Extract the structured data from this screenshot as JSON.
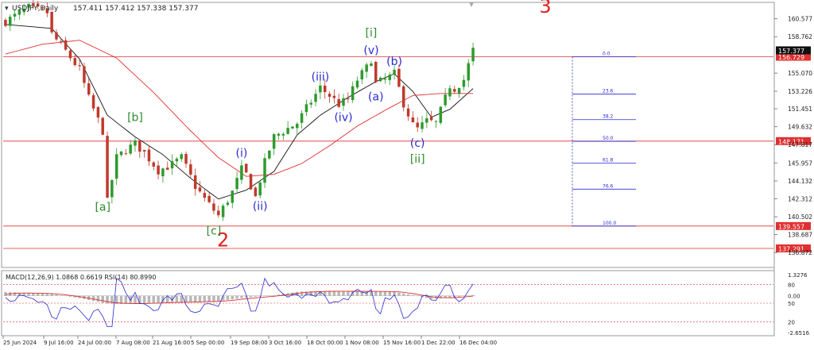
{
  "window": {
    "symbol_label": "USDJPY,Daily",
    "ohlc_label": "157.411 157.412 157.338 157.377"
  },
  "colors": {
    "bull": "#2e9a2e",
    "bear": "#c0392b",
    "ma_fast": "#111111",
    "ma_slow": "#e03030",
    "hline": "#e03030",
    "wave_blue": "#2a2ad0",
    "wave_green": "#2e8b2e",
    "wave_red": "#e02020",
    "fib": "#2a2ad0",
    "price_tag": "#111111"
  },
  "chart_data": [
    {
      "type": "candlestick",
      "title": "USDJPY,Daily",
      "subtitle": "157.411 157.412 157.338 157.377",
      "ylim": [
        135.6,
        162.0
      ],
      "x_tick_labels": [
        "25 Jun 2024",
        "9 Jul 16:00",
        "24 Jul 00:00",
        "7 Aug 08:00",
        "21 Aug 16:00",
        "5 Sep 00:00",
        "19 Sep 08:00",
        "3 Oct 16:00",
        "18 Oct 00:00",
        "1 Nov 08:00",
        "15 Nov 16:00",
        "1 Dec 22:00",
        "16 Dec 04:00"
      ],
      "y_tick_labels": [
        "160.577",
        "158.762",
        "155.070",
        "153.226",
        "151.451",
        "149.632",
        "147.817",
        "145.957",
        "144.132",
        "142.312",
        "140.502",
        "138.687",
        "136.872"
      ],
      "current_price": "157.377",
      "horizontal_levels": [
        {
          "value": 156.729,
          "label": "156.729"
        },
        {
          "value": 148.171,
          "label": "148.171"
        },
        {
          "value": 139.557,
          "label": "139.557"
        },
        {
          "value": 137.291,
          "label": "137.291"
        }
      ],
      "fib_levels": [
        {
          "label": "0.0",
          "value": 156.73
        },
        {
          "label": "23.6",
          "value": 152.95
        },
        {
          "label": "38.2",
          "value": 150.35
        },
        {
          "label": "50.0",
          "value": 148.15
        },
        {
          "label": "61.8",
          "value": 145.95
        },
        {
          "label": "76.6",
          "value": 143.3
        },
        {
          "label": "100.0",
          "value": 139.56
        }
      ],
      "wave_labels": [
        {
          "text": "3",
          "color": "red",
          "bar": 112,
          "price": 161.2,
          "size": 24
        },
        {
          "text": "2",
          "color": "red",
          "bar": 47,
          "price": 137.5,
          "size": 24
        },
        {
          "text": "[i]",
          "color": "green",
          "bar": 79,
          "price": 158.8,
          "size": 14
        },
        {
          "text": "(v)",
          "color": "blue",
          "bar": 79,
          "price": 157.0,
          "size": 14
        },
        {
          "text": "(b)",
          "color": "blue",
          "bar": 84,
          "price": 155.9,
          "size": 14
        },
        {
          "text": "(iii)",
          "color": "blue",
          "bar": 68,
          "price": 154.3,
          "size": 14
        },
        {
          "text": "(a)",
          "color": "blue",
          "bar": 80,
          "price": 152.3,
          "size": 14
        },
        {
          "text": "(iv)",
          "color": "blue",
          "bar": 73,
          "price": 150.2,
          "size": 14
        },
        {
          "text": "(c)",
          "color": "blue",
          "bar": 89,
          "price": 147.6,
          "size": 14
        },
        {
          "text": "[ii]",
          "color": "green",
          "bar": 89,
          "price": 146.0,
          "size": 14
        },
        {
          "text": "[b]",
          "color": "green",
          "bar": 28,
          "price": 150.2,
          "size": 14
        },
        {
          "text": "(i)",
          "color": "blue",
          "bar": 51,
          "price": 146.6,
          "size": 14
        },
        {
          "text": "(ii)",
          "color": "blue",
          "bar": 55,
          "price": 141.2,
          "size": 14
        },
        {
          "text": "[a]",
          "color": "green",
          "bar": 21,
          "price": 141.1,
          "size": 14
        },
        {
          "text": "[c]",
          "color": "green",
          "bar": 45,
          "price": 138.7,
          "size": 14
        }
      ],
      "series": [
        {
          "name": "Price",
          "close_path": [
            {
              "bar": 0,
              "price": 160.3
            },
            {
              "bar": 5,
              "price": 161.7
            },
            {
              "bar": 9,
              "price": 161.2
            },
            {
              "bar": 10,
              "price": 159.0
            },
            {
              "bar": 13,
              "price": 157.3
            },
            {
              "bar": 16,
              "price": 155.4
            },
            {
              "bar": 18,
              "price": 152.5
            },
            {
              "bar": 21,
              "price": 149.2
            },
            {
              "bar": 22,
              "price": 142.0
            },
            {
              "bar": 24,
              "price": 146.5
            },
            {
              "bar": 26,
              "price": 147.3
            },
            {
              "bar": 28,
              "price": 147.9
            },
            {
              "bar": 30,
              "price": 147.0
            },
            {
              "bar": 33,
              "price": 145.2
            },
            {
              "bar": 36,
              "price": 145.8
            },
            {
              "bar": 38,
              "price": 146.5
            },
            {
              "bar": 41,
              "price": 143.6
            },
            {
              "bar": 43,
              "price": 142.3
            },
            {
              "bar": 46,
              "price": 140.6
            },
            {
              "bar": 49,
              "price": 143.0
            },
            {
              "bar": 51,
              "price": 145.3
            },
            {
              "bar": 52,
              "price": 144.8
            },
            {
              "bar": 54,
              "price": 142.5
            },
            {
              "bar": 56,
              "price": 146.0
            },
            {
              "bar": 58,
              "price": 148.6
            },
            {
              "bar": 60,
              "price": 149.2
            },
            {
              "bar": 63,
              "price": 150.0
            },
            {
              "bar": 65,
              "price": 151.5
            },
            {
              "bar": 68,
              "price": 153.6
            },
            {
              "bar": 70,
              "price": 152.8
            },
            {
              "bar": 72,
              "price": 151.9
            },
            {
              "bar": 74,
              "price": 152.4
            },
            {
              "bar": 76,
              "price": 154.4
            },
            {
              "bar": 78,
              "price": 155.6
            },
            {
              "bar": 79,
              "price": 156.5
            },
            {
              "bar": 80,
              "price": 154.0
            },
            {
              "bar": 82,
              "price": 154.4
            },
            {
              "bar": 84,
              "price": 155.0
            },
            {
              "bar": 86,
              "price": 152.0
            },
            {
              "bar": 88,
              "price": 149.8
            },
            {
              "bar": 89,
              "price": 149.4
            },
            {
              "bar": 91,
              "price": 150.2
            },
            {
              "bar": 93,
              "price": 150.0
            },
            {
              "bar": 95,
              "price": 152.5
            },
            {
              "bar": 96,
              "price": 153.8
            },
            {
              "bar": 97,
              "price": 153.5
            },
            {
              "bar": 99,
              "price": 154.4
            },
            {
              "bar": 101,
              "price": 157.4
            }
          ]
        },
        {
          "name": "MA fast",
          "points": [
            {
              "bar": 0,
              "price": 160.0
            },
            {
              "bar": 10,
              "price": 159.6
            },
            {
              "bar": 16,
              "price": 156.5
            },
            {
              "bar": 22,
              "price": 150.8
            },
            {
              "bar": 28,
              "price": 148.6
            },
            {
              "bar": 34,
              "price": 146.8
            },
            {
              "bar": 40,
              "price": 144.4
            },
            {
              "bar": 46,
              "price": 142.3
            },
            {
              "bar": 52,
              "price": 143.2
            },
            {
              "bar": 58,
              "price": 145.1
            },
            {
              "bar": 63,
              "price": 148.8
            },
            {
              "bar": 68,
              "price": 150.8
            },
            {
              "bar": 74,
              "price": 152.6
            },
            {
              "bar": 80,
              "price": 154.2
            },
            {
              "bar": 84,
              "price": 155.0
            },
            {
              "bar": 88,
              "price": 153.2
            },
            {
              "bar": 92,
              "price": 150.6
            },
            {
              "bar": 96,
              "price": 151.4
            },
            {
              "bar": 101,
              "price": 153.5
            }
          ]
        },
        {
          "name": "MA slow",
          "points": [
            {
              "bar": 0,
              "price": 157.0
            },
            {
              "bar": 8,
              "price": 158.0
            },
            {
              "bar": 16,
              "price": 158.4
            },
            {
              "bar": 24,
              "price": 156.6
            },
            {
              "bar": 32,
              "price": 153.1
            },
            {
              "bar": 40,
              "price": 149.2
            },
            {
              "bar": 46,
              "price": 146.5
            },
            {
              "bar": 52,
              "price": 144.6
            },
            {
              "bar": 58,
              "price": 144.8
            },
            {
              "bar": 64,
              "price": 145.9
            },
            {
              "bar": 70,
              "price": 147.7
            },
            {
              "bar": 76,
              "price": 149.7
            },
            {
              "bar": 82,
              "price": 151.3
            },
            {
              "bar": 88,
              "price": 152.8
            },
            {
              "bar": 94,
              "price": 153.0
            },
            {
              "bar": 101,
              "price": 153.0
            }
          ]
        }
      ]
    },
    {
      "type": "line",
      "title": "MACD(12,26,9) 1.0868 0.6619 RSI(14) 80.8990",
      "y_tick_labels": [
        "1.3276",
        "80",
        "0.00",
        "50",
        "20",
        "-2.6516"
      ],
      "levels": [
        80,
        50,
        20
      ],
      "series": [
        {
          "name": "MACD histogram",
          "note": ""
        },
        {
          "name": "Signal",
          "note": ""
        },
        {
          "name": "RSI(14)",
          "last": 80.899
        }
      ]
    }
  ]
}
